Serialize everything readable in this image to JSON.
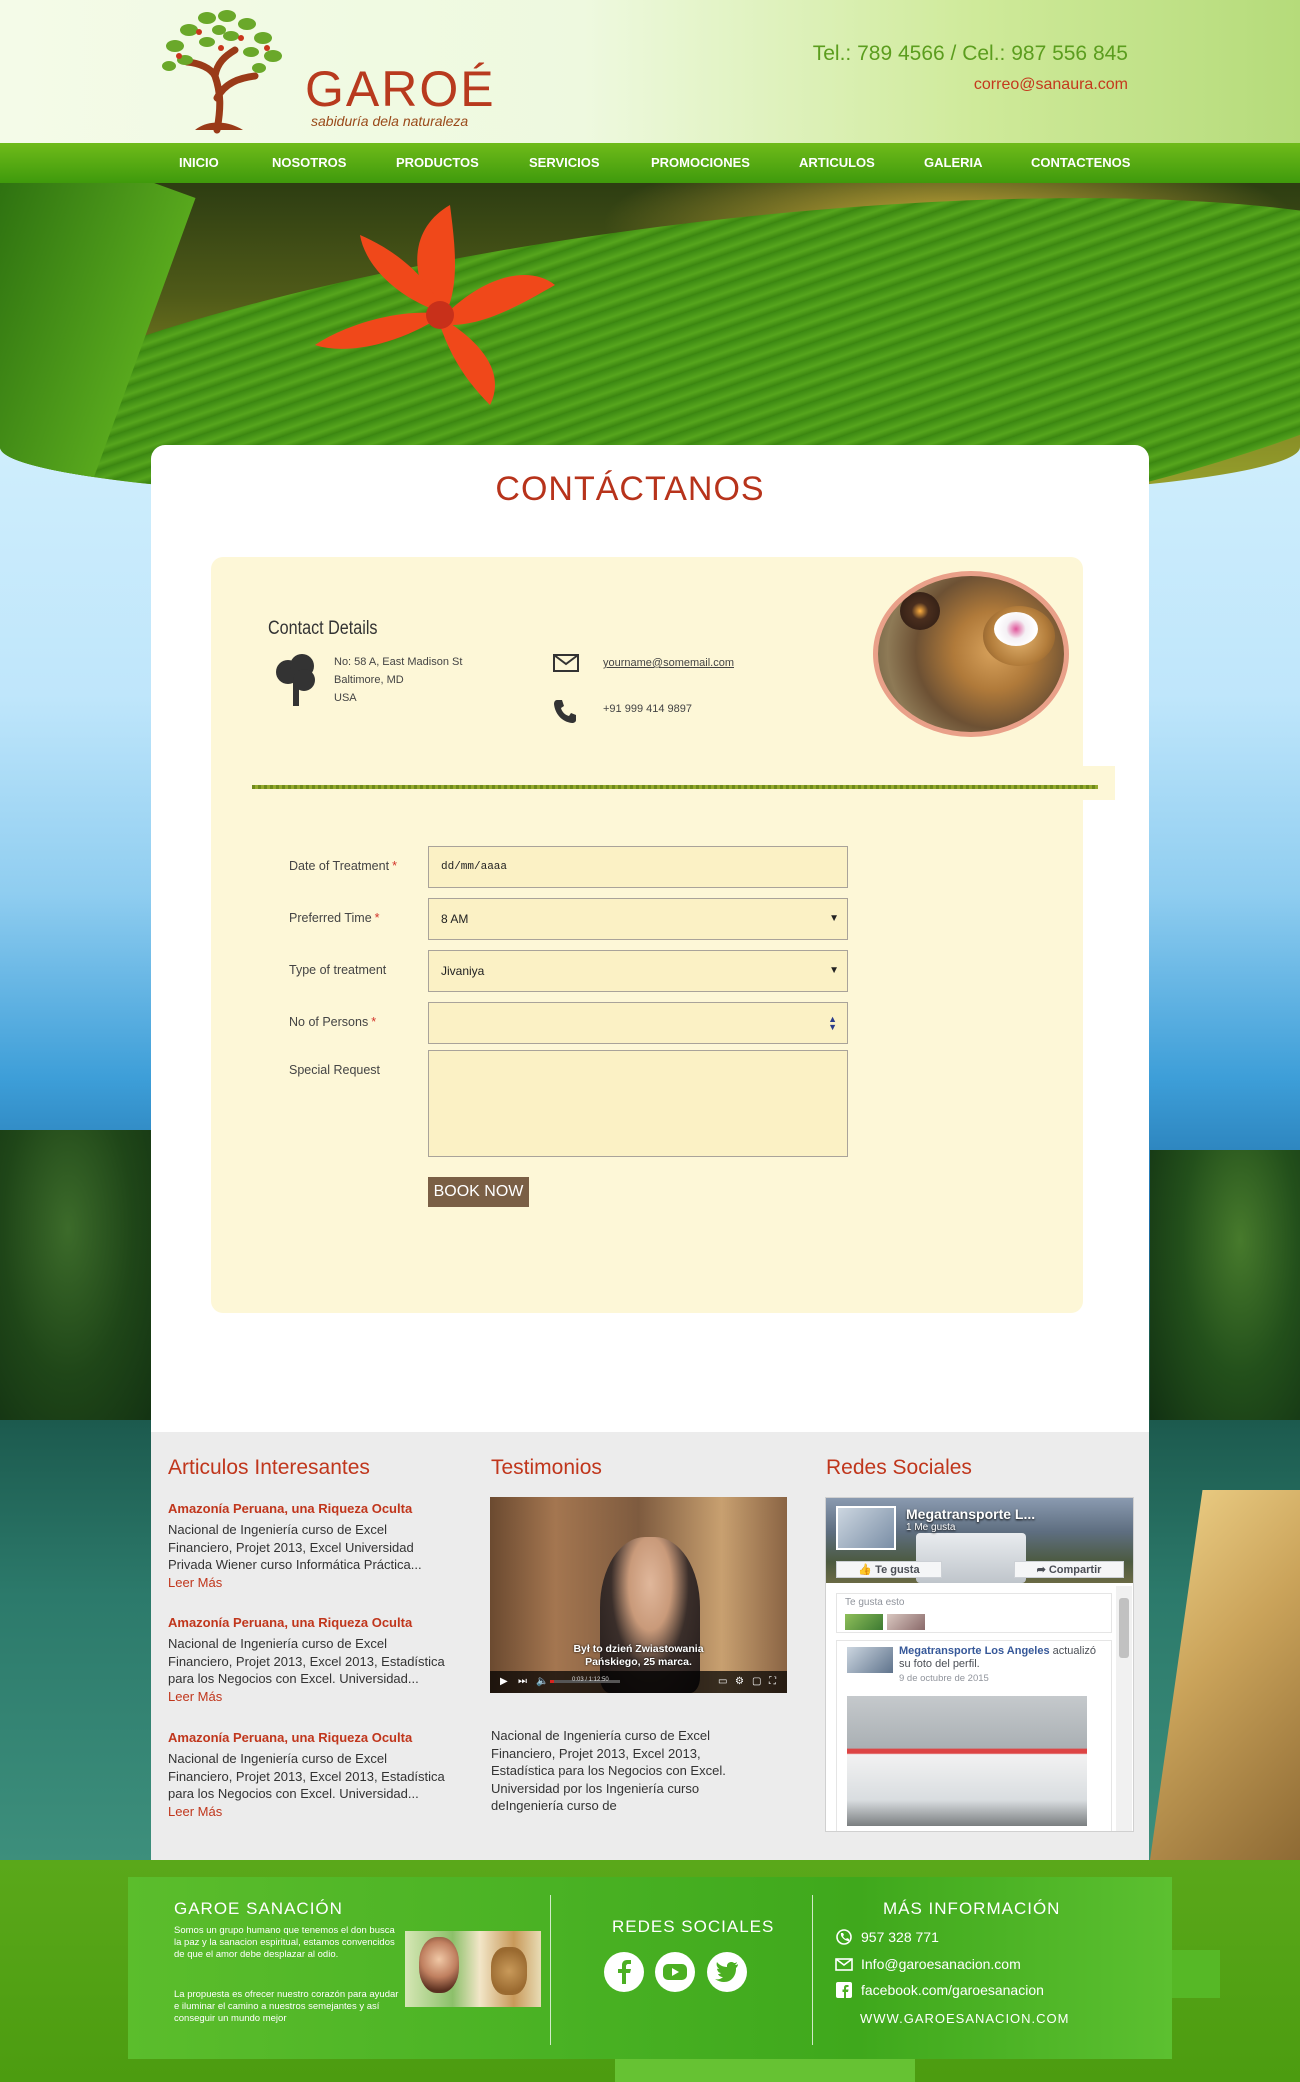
{
  "header": {
    "brand_name": "GAROÉ",
    "brand_tagline": "sabiduría dela naturaleza",
    "phone": "Tel.: 789 4566 / Cel.: 987 556 845",
    "email": "correo@sanaura.com"
  },
  "nav": {
    "items": [
      {
        "label": "INICIO"
      },
      {
        "label": "NOSOTROS"
      },
      {
        "label": "PRODUCTOS"
      },
      {
        "label": "SERVICIOS"
      },
      {
        "label": "PROMOCIONES"
      },
      {
        "label": "ARTICULOS"
      },
      {
        "label": "GALERIA"
      },
      {
        "label": "CONTACTENOS"
      }
    ]
  },
  "page": {
    "title": "CONTÁCTANOS"
  },
  "contact": {
    "title": "Contact Details",
    "address_lines": [
      "No: 58 A, East Madison St",
      "Baltimore, MD",
      "USA"
    ],
    "email": "yourname@somemail.com",
    "phone": "+91 999 414 9897"
  },
  "form": {
    "date_label": "Date of Treatment",
    "date_placeholder": "dd/mm/aaaa",
    "time_label": "Preferred Time",
    "time_value": "8 AM",
    "treatment_label": "Type of treatment",
    "treatment_value": "Jivaniya",
    "persons_label": "No of Persons",
    "persons_value": "",
    "request_label": "Special Request",
    "required_mark": "*",
    "submit_label": "BOOK NOW"
  },
  "articles": {
    "title": "Articulos Interesantes",
    "items": [
      {
        "title": "Amazonía Peruana, una Riqueza Oculta",
        "body": "Nacional de Ingeniería curso de Excel Financiero, Projet 2013, Excel  Universidad Privada Wiener curso Informática Práctica...",
        "more": "Leer Más"
      },
      {
        "title": "Amazonía Peruana, una Riqueza Oculta",
        "body": "Nacional de Ingeniería curso de Excel Financiero, Projet 2013, Excel 2013, Estadística para los Negocios con Excel. Universidad...",
        "more": "Leer Más"
      },
      {
        "title": "Amazonía Peruana, una Riqueza Oculta",
        "body": "Nacional de Ingeniería curso de Excel Financiero, Projet 2013, Excel 2013, Estadística para los Negocios con Excel. Universidad...",
        "more": "Leer Más"
      }
    ]
  },
  "testimonials": {
    "title": "Testimonios",
    "video_subtitle_1": "Był to dzień Zwiastowania",
    "video_subtitle_2": "Pańskiego, 25 marca.",
    "video_time": "0:03 / 1:12:50",
    "video_progress": 0.05,
    "body": "Nacional de Ingeniería curso de Excel Financiero, Projet 2013, Excel 2013, Estadística para los Negocios con Excel. Universidad por los Ingeniería curso deIngeniería curso de"
  },
  "social": {
    "title": "Redes Sociales",
    "fb_page_name": "Megatransporte L...",
    "fb_likes": "1 Me gusta",
    "fb_like_button": "Te gusta",
    "fb_share_button": "Compartir",
    "fb_like_label": "Te gusta esto",
    "fb_post_name": "Megatransporte Los Angeles",
    "fb_post_text": " actualizó su foto del perfil.",
    "fb_post_date": "9 de octubre de 2015"
  },
  "footer": {
    "about_title": "GAROE SANACIÓN",
    "about_p1": "Somos un grupo humano que tenemos el don busca la paz y la sanacion espiritual, estamos convencidos de que el amor debe desplazar al odio.",
    "about_p2": "La propuesta es ofrecer nuestro corazón para ayudar e iluminar el camino a nuestros semejantes y así conseguir un mundo mejor",
    "social_title": "REDES SOCIALES",
    "info_title": "MÁS INFORMACIÓN",
    "whatsapp": "957 328 771",
    "email": "Info@garoesanacion.com",
    "facebook": "facebook.com/garoesanacion",
    "website": "WWW.GAROESANACION.COM"
  },
  "icons": [
    "tree-icon",
    "mail-icon",
    "phone-icon",
    "facebook-icon",
    "youtube-icon",
    "twitter-icon",
    "whatsapp-icon",
    "envelope-icon",
    "facebook-square-icon",
    "play-icon",
    "volume-icon",
    "settings-icon",
    "fullscreen-icon"
  ],
  "colors": {
    "brand_red": "#b7331b",
    "nav_green": "#4fa312",
    "panel_cream": "#fdf7d7",
    "button_brown": "#7a5f45",
    "footer_green": "#4ab224"
  }
}
